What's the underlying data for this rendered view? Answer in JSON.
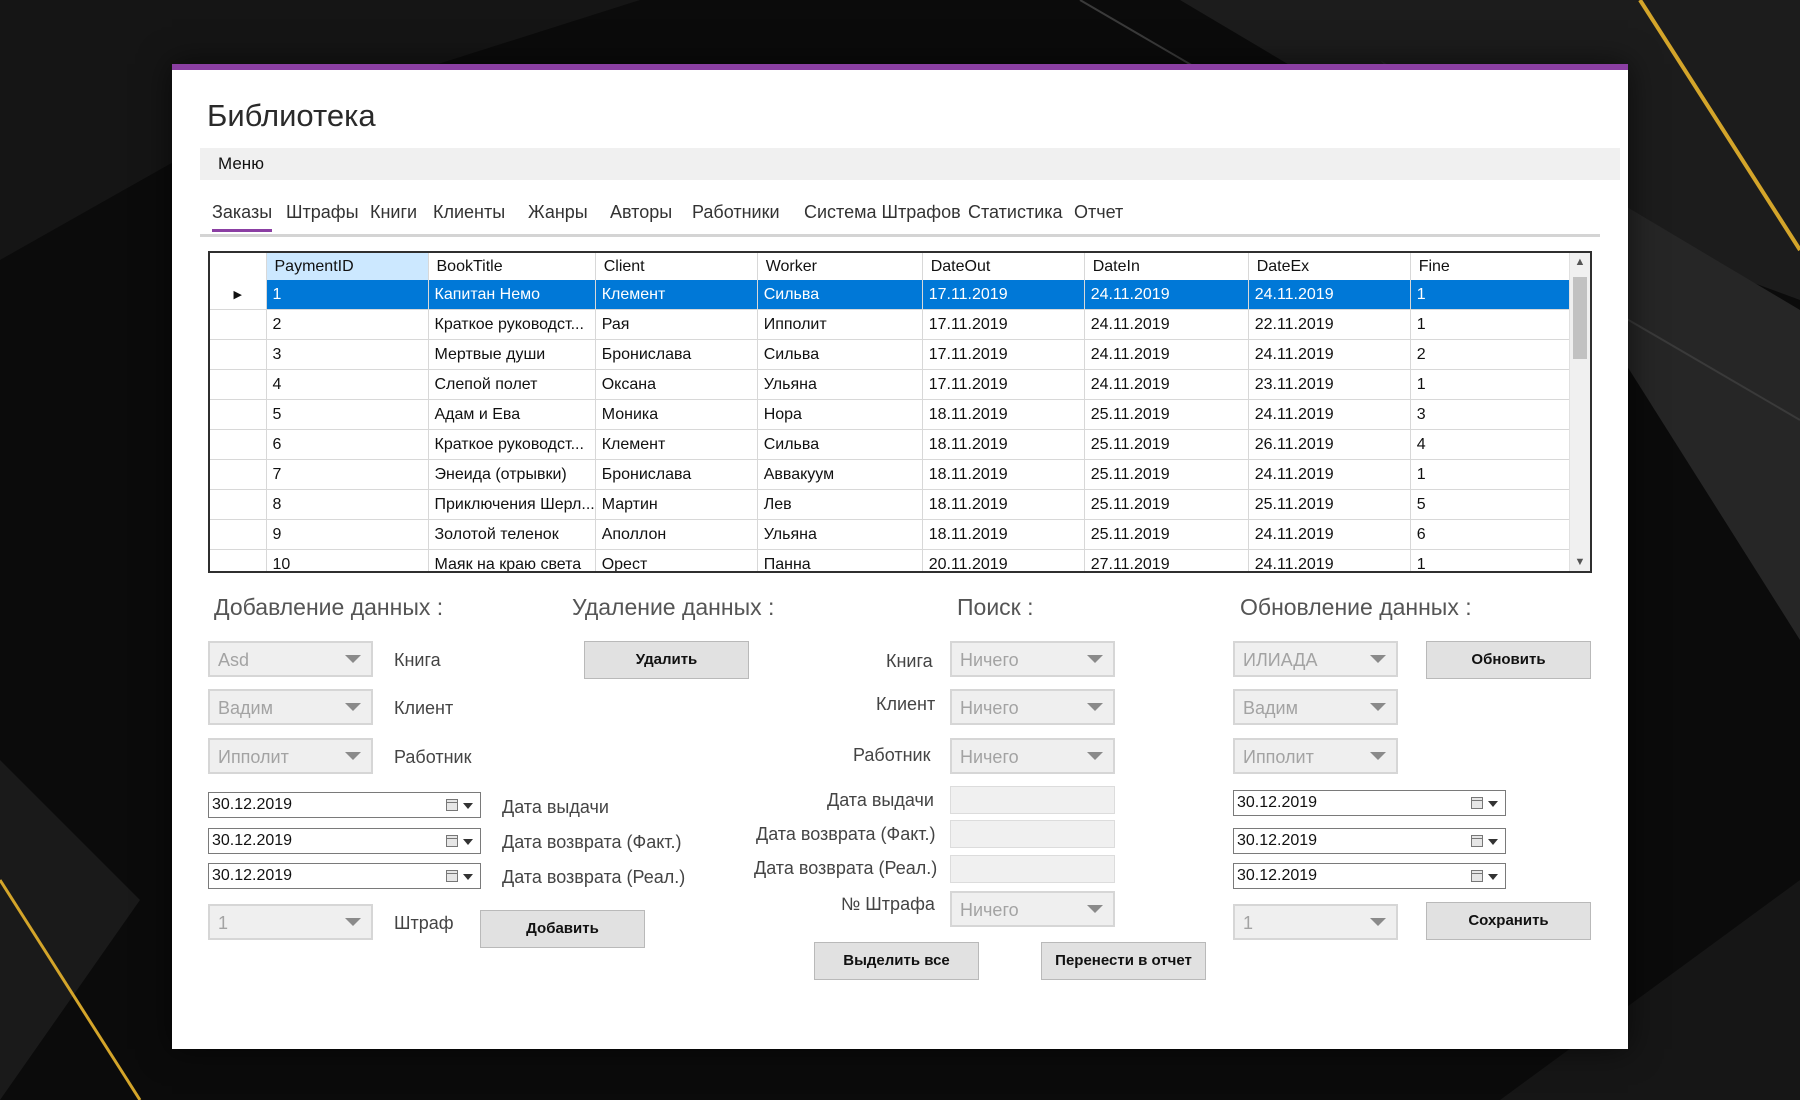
{
  "app": {
    "title": "Библиотека"
  },
  "menu": {
    "label": "Меню"
  },
  "tabs": [
    {
      "label": "Заказы",
      "active": true
    },
    {
      "label": "Штрафы"
    },
    {
      "label": "Книги"
    },
    {
      "label": "Клиенты"
    },
    {
      "label": "Жанры"
    },
    {
      "label": "Авторы"
    },
    {
      "label": "Работники"
    },
    {
      "label": "Система Штрафов"
    },
    {
      "label": "Статистика"
    },
    {
      "label": "Отчет"
    }
  ],
  "grid": {
    "columns": [
      "PaymentID",
      "BookTitle",
      "Client",
      "Worker",
      "DateOut",
      "DateIn",
      "DateEx",
      "Fine"
    ],
    "selected_row": 0,
    "rows": [
      [
        "1",
        "Капитан Немо",
        "Клемент",
        "Сильва",
        "17.11.2019",
        "24.11.2019",
        "24.11.2019",
        "1"
      ],
      [
        "2",
        "Краткое руководст...",
        "Рая",
        "Ипполит",
        "17.11.2019",
        "24.11.2019",
        "22.11.2019",
        "1"
      ],
      [
        "3",
        "Мертвые души",
        "Бронислава",
        "Сильва",
        "17.11.2019",
        "24.11.2019",
        "24.11.2019",
        "2"
      ],
      [
        "4",
        "Слепой полет",
        "Оксана",
        "Ульяна",
        "17.11.2019",
        "24.11.2019",
        "23.11.2019",
        "1"
      ],
      [
        "5",
        "Адам и Ева",
        "Моника",
        "Нора",
        "18.11.2019",
        "25.11.2019",
        "24.11.2019",
        "3"
      ],
      [
        "6",
        "Краткое руководст...",
        "Клемент",
        "Сильва",
        "18.11.2019",
        "25.11.2019",
        "26.11.2019",
        "4"
      ],
      [
        "7",
        "Энеида (отрывки)",
        "Бронислава",
        "Аввакуум",
        "18.11.2019",
        "25.11.2019",
        "24.11.2019",
        "1"
      ],
      [
        "8",
        "Приключения Шерл...",
        "Мартин",
        "Лев",
        "18.11.2019",
        "25.11.2019",
        "25.11.2019",
        "5"
      ],
      [
        "9",
        "Золотой теленок",
        "Аполлон",
        "Ульяна",
        "18.11.2019",
        "25.11.2019",
        "24.11.2019",
        "6"
      ],
      [
        "10",
        "Маяк на краю света",
        "Орест",
        "Панна",
        "20.11.2019",
        "27.11.2019",
        "24.11.2019",
        "1"
      ]
    ]
  },
  "add": {
    "title": "Добавление данных :",
    "book_value": "Asd",
    "book_label": "Книга",
    "client_value": "Вадим",
    "client_label": "Клиент",
    "worker_value": "Ипполит",
    "worker_label": "Работник",
    "date_out": "30.12.2019",
    "date_out_label": "Дата выдачи",
    "date_in": "30.12.2019",
    "date_in_label": "Дата возврата (Факт.)",
    "date_ex": "30.12.2019",
    "date_ex_label": "Дата возврата (Реал.)",
    "fine_value": "1",
    "fine_label": "Штраф",
    "button": "Добавить"
  },
  "delete": {
    "title": "Удаление данных :",
    "button": "Удалить"
  },
  "search": {
    "title": "Поиск :",
    "book_label": "Книга",
    "book_value": "Ничего",
    "client_label": "Клиент",
    "client_value": "Ничего",
    "worker_label": "Работник",
    "worker_value": "Ничего",
    "date_out_label": "Дата выдачи",
    "date_in_label": "Дата возврата (Факт.)",
    "date_ex_label": "Дата возврата (Реал.)",
    "fine_label": "№ Штрафа",
    "fine_value": "Ничего",
    "select_all_button": "Выделить все",
    "report_button": "Перенести в отчет"
  },
  "update": {
    "title": "Обновление данных :",
    "book_value": "ИЛИАДА",
    "client_value": "Вадим",
    "worker_value": "Ипполит",
    "date_out": "30.12.2019",
    "date_in": "30.12.2019",
    "date_ex": "30.12.2019",
    "fine_value": "1",
    "update_button": "Обновить",
    "save_button": "Сохранить"
  },
  "colors": {
    "accent": "#8b3fa3",
    "selection": "#0078d7",
    "header_selected": "#cce8ff",
    "backdrop_gold": "#d4a52a"
  }
}
